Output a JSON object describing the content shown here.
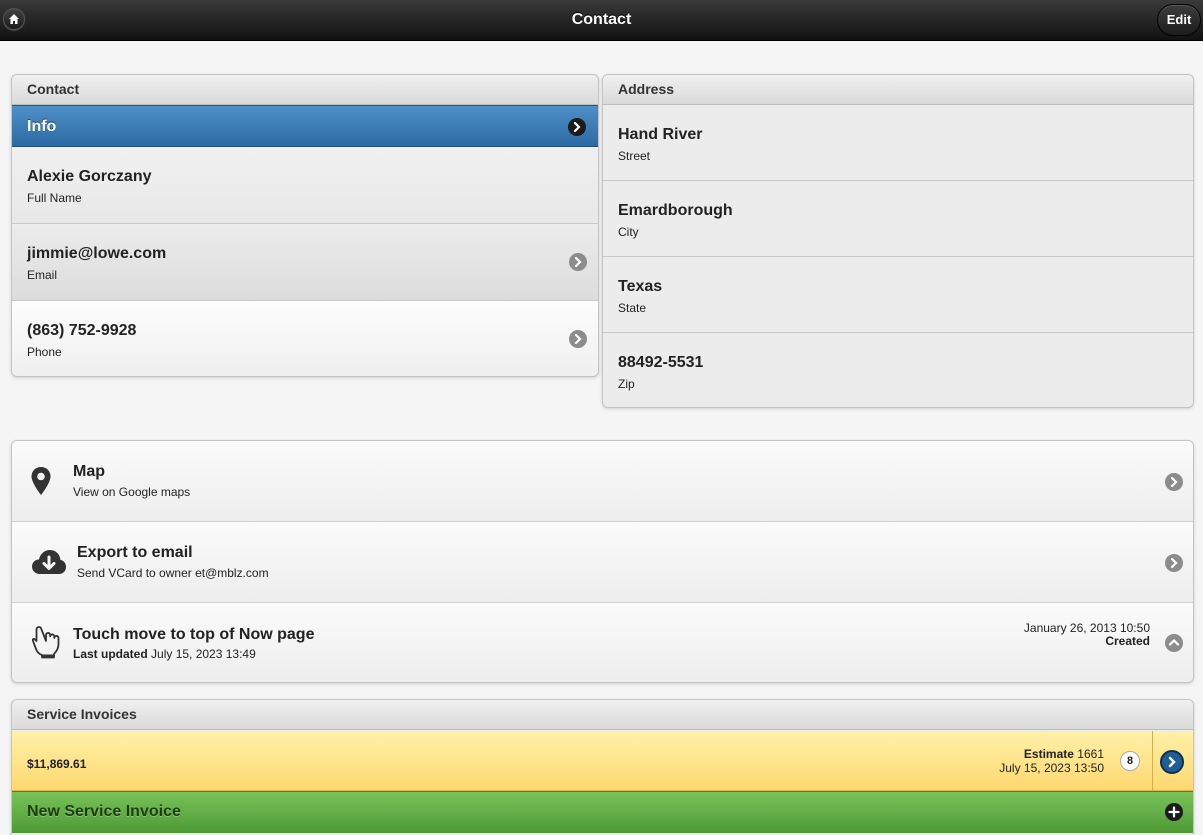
{
  "header": {
    "title": "Contact",
    "edit_label": "Edit"
  },
  "contact": {
    "heading": "Contact",
    "info_label": "Info",
    "fields": [
      {
        "value": "Alexie Gorczany",
        "label": "Full Name"
      },
      {
        "value": "jimmie@lowe.com",
        "label": "Email"
      },
      {
        "value": "(863) 752-9928",
        "label": "Phone"
      }
    ]
  },
  "address": {
    "heading": "Address",
    "fields": [
      {
        "value": "Hand River",
        "label": "Street"
      },
      {
        "value": "Emardborough",
        "label": "City"
      },
      {
        "value": "Texas",
        "label": "State"
      },
      {
        "value": "88492-5531",
        "label": "Zip"
      }
    ]
  },
  "actions": {
    "map": {
      "title": "Map",
      "subtitle": "View on Google maps"
    },
    "export": {
      "title": "Export to email",
      "subtitle": "Send VCard to owner et@mblz.com"
    },
    "touch": {
      "title": "Touch move to top of Now page",
      "updated_label": "Last updated",
      "updated_value": "July 15, 2023 13:49",
      "created_date": "January 26, 2013 10:50",
      "created_label": "Created"
    }
  },
  "invoices": {
    "heading": "Service Invoices",
    "items": [
      {
        "amount": "$11,869.61",
        "type": "Estimate",
        "number": "1661",
        "date": "July 15, 2023 13:50",
        "count": "8"
      }
    ],
    "new_label": "New Service Invoice"
  },
  "colors": {
    "info_blue": "#2c6aa4",
    "invoice_yellow": "#fdd870",
    "new_green": "#4d9a35"
  },
  "icons": [
    "home-icon",
    "arrow-right-icon",
    "map-pin-icon",
    "cloud-download-icon",
    "touch-hand-icon",
    "arrow-up-icon",
    "plus-icon"
  ]
}
